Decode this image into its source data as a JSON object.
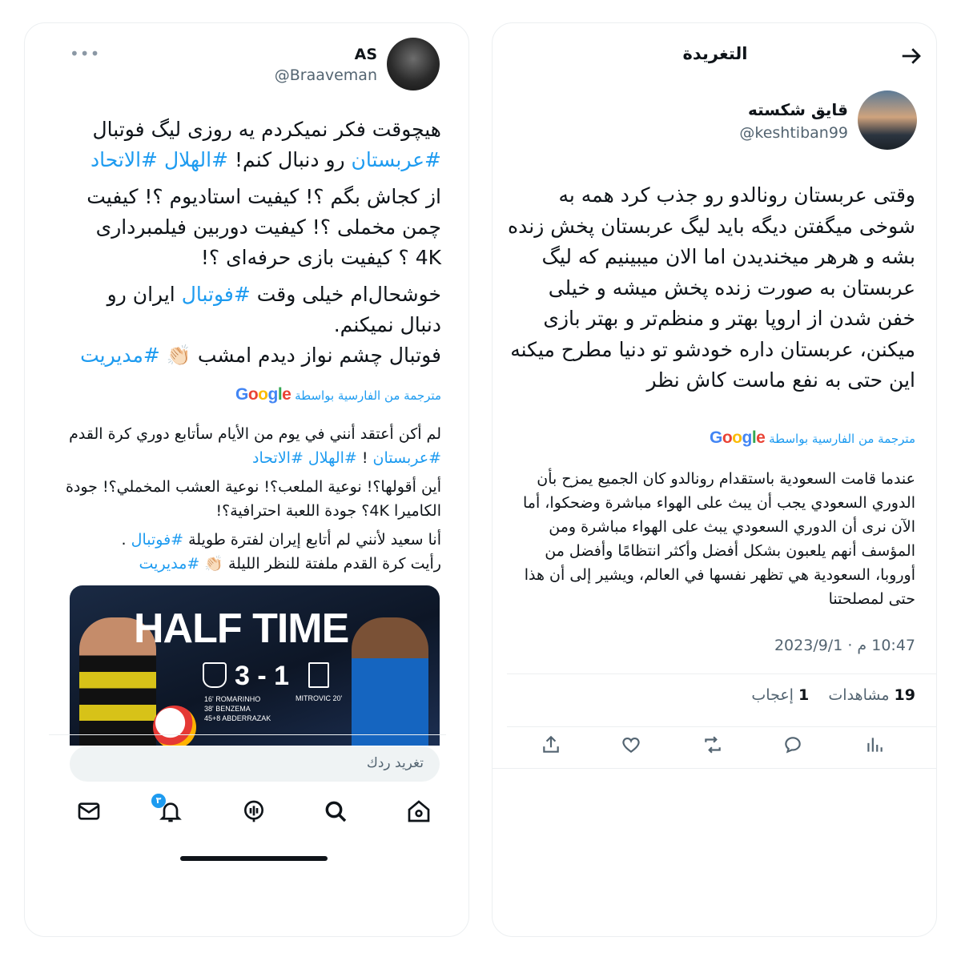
{
  "left": {
    "tweet": {
      "author_name": "AS",
      "author_handle": "@Braaveman",
      "more_icon": "more-icon",
      "body": {
        "p1_text": "هیچوقت فکر نمیکردم یه روزی لیگ فوتبال",
        "p1_tag_arabia": "#عربستان",
        "p1_mid": "رو دنبال کنم!",
        "p1_tag_hilal": "#الهلال",
        "p1_tag_ittihad": "#الاتحاد",
        "p2": "از کجاش بگم ؟! کیفیت استادیوم ؟! کیفیت چمن مخملی ؟! کیفیت دوربین فیلمبرداری 4K ؟ کیفیت بازی حرفه‌ای ؟!",
        "p3_text": "خوشحال‌ام خیلی وقت",
        "p3_tag_football": "#فوتبال",
        "p3_rest": "ایران رو دنبال نمیکنم.",
        "p4_text": "فوتبال چشم نواز دیدم امشب 👏🏻",
        "p4_tag_management": "#مدیریت"
      },
      "translated_by": "مترجمة من الفارسية بواسطة",
      "google_logo": "Google",
      "translation": {
        "t1_text": "لم أكن أعتقد أنني في يوم من الأيام سأتابع دوري كرة القدم",
        "t1_tag_arabia": "#عربستان",
        "t1_mid": "!",
        "t1_tag_hilal": "#الهلال",
        "t1_tag_ittihad": "#الاتحاد",
        "t2": "أين أقولها؟! نوعية الملعب؟! نوعية العشب المخملي؟! جودة الكاميرا 4K؟ جودة اللعبة احترافية؟!",
        "t3_text": "أنا سعيد لأنني لم أتابع إيران لفترة طويلة",
        "t3_tag_football": "#فوتبال",
        "t3_end": ".",
        "t4_text": "رأيت كرة القدم ملفتة للنظر الليلة 👏🏻",
        "t4_tag_management": "#مديريت"
      },
      "media": {
        "headline": "HALF TIME",
        "score": "3 - 1",
        "scorers_left": [
          "16' ROMARINHO",
          "38' BENZEMA",
          "45+8 ABDERRAZAK"
        ],
        "scorers_right": "MITROVIC 20'"
      }
    },
    "reply_placeholder": "تغريد ردك",
    "bottom_nav": {
      "items": [
        "mail-icon",
        "bell-icon",
        "spaces-icon",
        "search-icon",
        "home-icon"
      ],
      "notifications_badge": "٣"
    }
  },
  "right": {
    "header": {
      "title": "التغريدة",
      "back_icon": "arrow-right-icon"
    },
    "tweet": {
      "author_name": "قایق شکسته",
      "author_handle": "@keshtiban99",
      "body": "وقتی عربستان رونالدو رو جذب کرد همه به شوخی میگفتن دیگه باید لیگ عربستان پخش زنده بشه و هرهر میخندیدن اما الان میبینیم که لیگ عربستان به صورت زنده پخش میشه و خیلی خفن شدن از اروپا بهتر و منظم‌تر و بهتر بازی میکنن، عربستان داره خودشو تو دنیا مطرح میکنه این حتی به نفع ماست کاش نظر",
      "translated_by": "مترجمة من الفارسية بواسطة",
      "google_logo": "Google",
      "translation": "عندما قامت السعودية باستقدام رونالدو كان الجميع يمزح بأن الدوري السعودي يجب أن يبث على الهواء مباشرة وضحكوا، أما الآن نرى أن الدوري السعودي يبث على الهواء مباشرة ومن المؤسف أنهم يلعبون بشكل أفضل وأكثر انتظامًا وأفضل من أوروبا، السعودية هي تظهر نفسها في العالم، ويشير إلى أن هذا حتى لمصلحتنا",
      "timestamp": "10:47 م · 2023/9/1",
      "views_count": "19",
      "views_label": "مشاهدات",
      "likes_count": "1",
      "likes_label": "إعجاب"
    },
    "actions": [
      "share-icon",
      "like-icon",
      "retweet-icon",
      "reply-icon",
      "views-icon"
    ]
  },
  "colors": {
    "accent": "#1d9bf0",
    "text": "#0f1419",
    "muted": "#536471",
    "divider": "#eceff1"
  }
}
